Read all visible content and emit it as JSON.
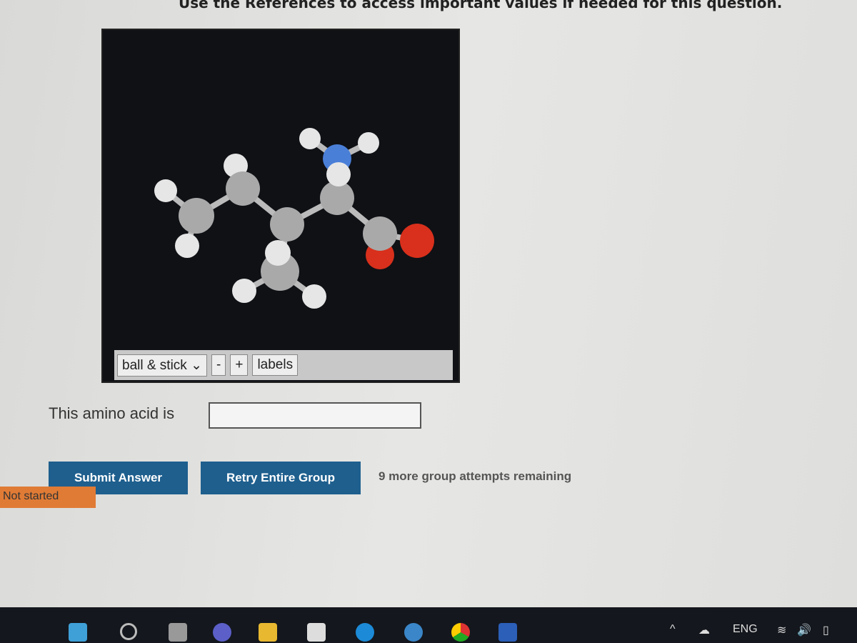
{
  "header": {
    "text": "Use the References to access important values if needed for this question."
  },
  "viewer": {
    "style_select": "ball & stick",
    "minus": "-",
    "plus": "+",
    "labels": "labels",
    "atom_colors": {
      "hydrogen": "#e8e8e8",
      "carbon": "#a8a8a8",
      "nitrogen": "#4a7fd8",
      "oxygen": "#d8301c"
    }
  },
  "question": {
    "prompt": "This amino acid is",
    "answer": ""
  },
  "buttons": {
    "submit": "Submit Answer",
    "retry": "Retry Entire Group"
  },
  "attempts": "9 more group attempts remaining",
  "status": "Not started",
  "taskbar": {
    "icons": [
      "windows-start-icon",
      "search-icon",
      "task-view-icon",
      "teams-icon",
      "file-explorer-icon",
      "store-icon",
      "edge-icon",
      "help-icon",
      "chrome-icon",
      "word-icon"
    ],
    "lang": "ENG"
  }
}
